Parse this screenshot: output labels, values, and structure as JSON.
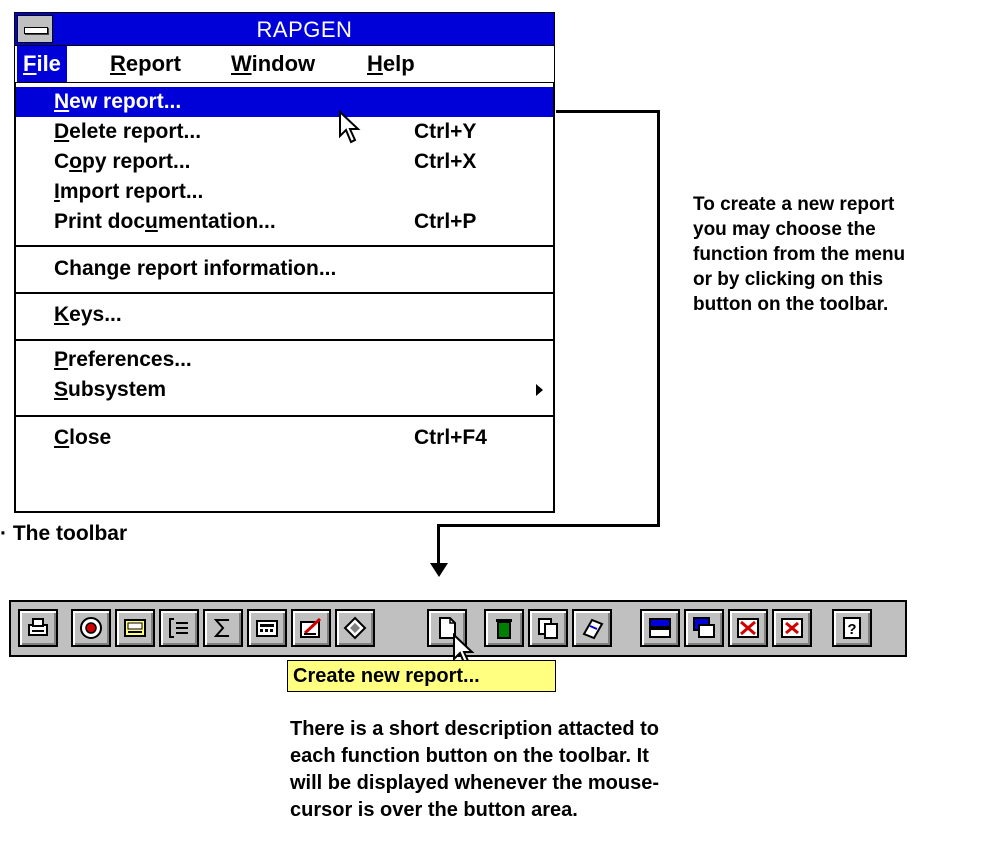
{
  "window": {
    "title": "RAPGEN"
  },
  "menubar": [
    {
      "label_u": "F",
      "label_rest": "ile",
      "active": true
    },
    {
      "label_u": "R",
      "label_rest": "eport"
    },
    {
      "label_u": "W",
      "label_rest": "indow"
    },
    {
      "label_u": "H",
      "label_rest": "elp"
    }
  ],
  "file_menu": {
    "new_report": {
      "pre": "",
      "u": "N",
      "post": "ew report..."
    },
    "delete_report": {
      "pre": "",
      "u": "D",
      "post": "elete report...",
      "shortcut": "Ctrl+Y"
    },
    "copy_report": {
      "pre": "C",
      "u": "o",
      "post": "py report...",
      "shortcut": "Ctrl+X"
    },
    "import_report": {
      "pre": "",
      "u": "I",
      "post": "mport report..."
    },
    "print_documentation": {
      "pre": "Print doc",
      "u": "u",
      "post": "mentation...",
      "shortcut": "Ctrl+P"
    },
    "change_report_info": {
      "label": "Change report information..."
    },
    "keys": {
      "pre": "",
      "u": "K",
      "post": "eys..."
    },
    "preferences": {
      "pre": "",
      "u": "P",
      "post": "references..."
    },
    "subsystem": {
      "pre": "",
      "u": "S",
      "post": "ubsystem"
    },
    "close": {
      "pre": "",
      "u": "C",
      "post": "lose",
      "shortcut": "Ctrl+F4"
    }
  },
  "annotations": {
    "right_note": [
      "To create a new report",
      "you may choose the",
      "function from the menu",
      "or by clicking on this",
      "button on the toolbar."
    ],
    "toolbar_caption": "· The toolbar",
    "bottom_note": [
      "There is a short description attacted to",
      "each function button on the toolbar. It",
      "will be displayed whenever the mouse-",
      "cursor is over the button area."
    ]
  },
  "toolbar": {
    "tooltip": "Create new report...",
    "buttons": [
      "printer-icon",
      "target-icon",
      "ab-field-icon",
      "bracket-list-icon",
      "sigma-icon",
      "calculator-icon",
      "chart-edit-icon",
      "diamond-icon",
      "new-document-icon",
      "trash-icon",
      "copy-icon",
      "import-icon",
      "tile-icon",
      "cascade-icon",
      "close-all-icon",
      "close-window-icon",
      "help-icon"
    ]
  },
  "colors": {
    "titlebar": "#0000d8",
    "highlight": "#0000d8",
    "toolbar": "#c0c0c0",
    "tooltip": "#ffff80"
  }
}
